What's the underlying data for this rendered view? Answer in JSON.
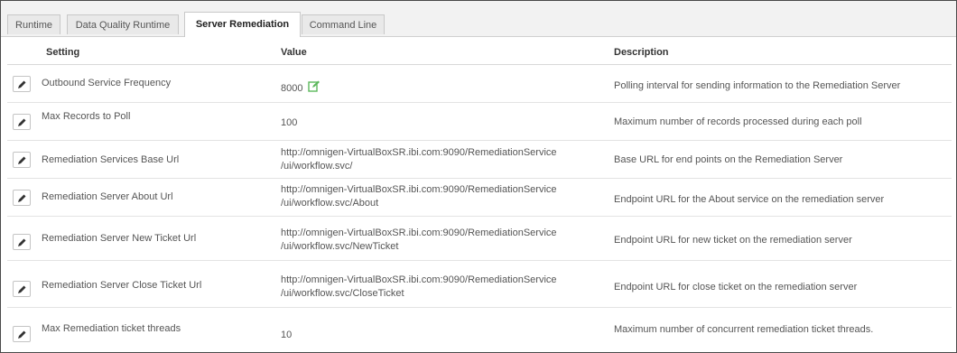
{
  "tabs": [
    {
      "label": "Runtime",
      "active": false
    },
    {
      "label": "Data Quality Runtime",
      "active": false
    },
    {
      "label": "Server Remediation",
      "active": true
    },
    {
      "label": "Command Line",
      "active": false
    }
  ],
  "columns": {
    "setting": "Setting",
    "value": "Value",
    "description": "Description"
  },
  "rows": [
    {
      "setting": "Outbound Service Frequency",
      "value_line1": "8000",
      "value_line2": "",
      "description": "Polling interval for sending information to the Remediation Server"
    },
    {
      "setting": "Max Records to Poll",
      "value_line1": "100",
      "value_line2": "",
      "description": "Maximum number of records processed during each poll"
    },
    {
      "setting": "Remediation Services Base Url",
      "value_line1": "http://omnigen-VirtualBoxSR.ibi.com:9090/RemediationService",
      "value_line2": "/ui/workflow.svc/",
      "description": "Base URL for end points on the Remediation Server"
    },
    {
      "setting": "Remediation Server About Url",
      "value_line1": "http://omnigen-VirtualBoxSR.ibi.com:9090/RemediationService",
      "value_line2": "/ui/workflow.svc/About",
      "description": "Endpoint URL for the About service on the remediation server"
    },
    {
      "setting": "Remediation Server New Ticket Url",
      "value_line1": "http://omnigen-VirtualBoxSR.ibi.com:9090/RemediationService",
      "value_line2": "/ui/workflow.svc/NewTicket",
      "description": "Endpoint URL for new ticket on the remediation server"
    },
    {
      "setting": "Remediation Server Close Ticket Url",
      "value_line1": "http://omnigen-VirtualBoxSR.ibi.com:9090/RemediationService",
      "value_line2": "/ui/workflow.svc/CloseTicket",
      "description": "Endpoint URL for close ticket on the remediation server"
    },
    {
      "setting": "Max Remediation ticket threads",
      "value_line1": "10",
      "value_line2": "",
      "description": "Maximum number of concurrent remediation ticket threads."
    }
  ],
  "icons": {
    "row_edit": "pencil-icon",
    "inline_edit": "edit-note-icon"
  },
  "colors": {
    "inline_edit_icon": "#5cb85c"
  }
}
